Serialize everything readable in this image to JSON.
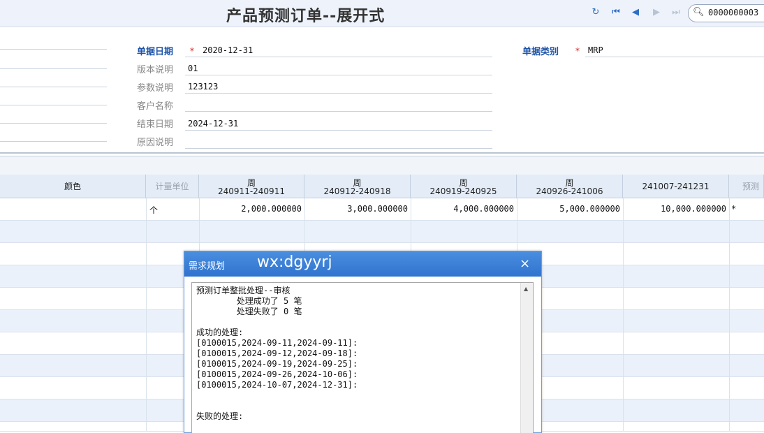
{
  "window": {
    "title": "产品预测订单--展开式"
  },
  "toolbar": {
    "refresh_icon": "refresh-icon",
    "first_icon": "first-page-icon",
    "prev_icon": "prev-page-icon",
    "next_icon": "next-page-icon",
    "last_icon": "last-page-icon",
    "search_value": "0000000003"
  },
  "form": {
    "doc_date": {
      "label": "单据日期",
      "value": "2020-12-31"
    },
    "doc_type": {
      "label": "单据类别",
      "value": "MRP"
    },
    "version": {
      "label": "版本说明",
      "value": "01"
    },
    "param": {
      "label": "参数说明",
      "value": "123123"
    },
    "customer": {
      "label": "客户名称",
      "value": ""
    },
    "end_date": {
      "label": "结束日期",
      "value": "2024-12-31"
    },
    "reason": {
      "label": "原因说明",
      "value": ""
    },
    "required_mark": "*"
  },
  "grid": {
    "headers": [
      {
        "l1": "颜色",
        "l2": ""
      },
      {
        "l1": "计量单位",
        "l2": ""
      },
      {
        "l1": "周",
        "l2": "240911-240911"
      },
      {
        "l1": "周",
        "l2": "240912-240918"
      },
      {
        "l1": "周",
        "l2": "240919-240925"
      },
      {
        "l1": "周",
        "l2": "240926-241006"
      },
      {
        "l1": "241007-241231",
        "l2": ""
      },
      {
        "l1": "预测",
        "l2": ""
      }
    ],
    "row1": {
      "unit": "个",
      "values": [
        "2,000.000000",
        "3,000.000000",
        "4,000.000000",
        "5,000.000000",
        "10,000.000000"
      ],
      "extra": "*"
    }
  },
  "dialog": {
    "title": "需求规划",
    "watermark": "wx:dgyyrj",
    "close": "×",
    "message": "预测订单整批处理--审核\n        处理成功了 5 笔\n        处理失败了 0 笔\n\n成功的处理:\n[0100015,2024-09-11,2024-09-11]:\n[0100015,2024-09-12,2024-09-18]:\n[0100015,2024-09-19,2024-09-25]:\n[0100015,2024-09-26,2024-10-06]:\n[0100015,2024-10-07,2024-12-31]:\n\n\n失败的处理:"
  }
}
